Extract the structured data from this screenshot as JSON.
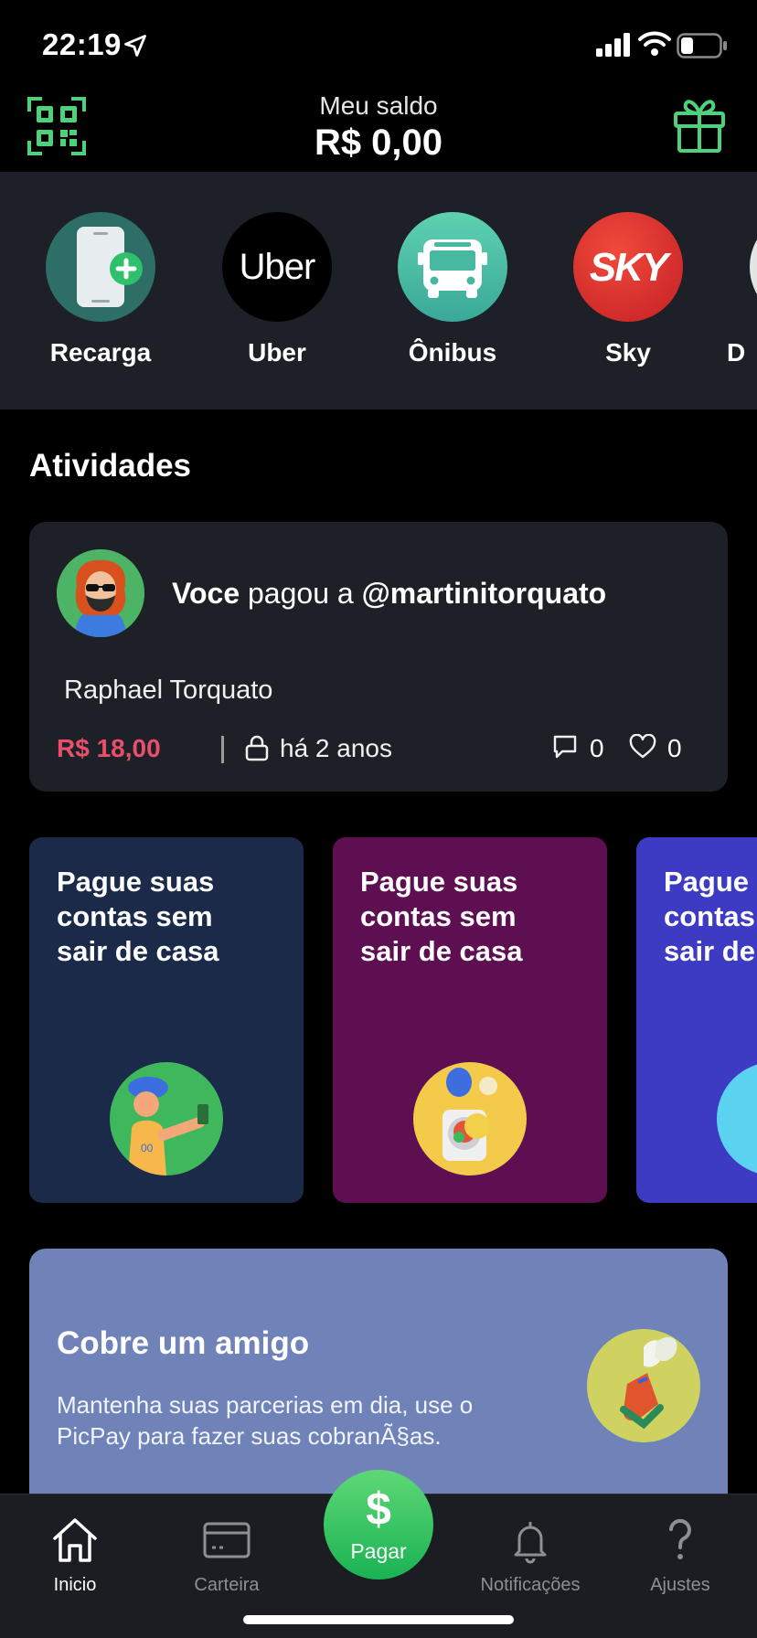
{
  "status_bar": {
    "time": "22:19"
  },
  "header": {
    "balance_label": "Meu saldo",
    "balance_value": "R$ 0,00"
  },
  "shortcuts": [
    {
      "label": "Recarga",
      "icon": "phone-plus-icon",
      "color": "#2d6e66"
    },
    {
      "label": "Uber",
      "icon": "uber-logo",
      "logo_text": "Uber",
      "color": "#000000"
    },
    {
      "label": "Ônibus",
      "icon": "bus-icon",
      "color": "#4cc2a4"
    },
    {
      "label": "Sky",
      "icon": "sky-logo",
      "logo_text": "SKY",
      "color": "#dd2a2a"
    },
    {
      "label": "D",
      "icon": "partial-icon",
      "color": "#e5e5e5"
    }
  ],
  "activities": {
    "section_title": "Atividades",
    "card": {
      "actor": "Voce",
      "verb": "pagou a",
      "target": "@martinitorquato",
      "description": "Raphael Torquato",
      "amount": "R$ 18,00",
      "time_ago": "há 2 anos",
      "comments": "0",
      "likes": "0"
    }
  },
  "promos": [
    {
      "text": "Pague suas contas sem sair de casa",
      "bg": "#1c2a4a",
      "circle": "#3fb75d"
    },
    {
      "text": "Pague suas contas sem sair de casa",
      "bg": "#5e0f52",
      "circle": "#f3ca4a"
    },
    {
      "text": "Pague suas contas sem sair de casa",
      "bg": "#3d3bc4",
      "circle": "#5ad2f0"
    }
  ],
  "cobre": {
    "title": "Cobre um amigo",
    "description": "Mantenha suas parcerias em dia, use o PicPay para fazer suas cobranÃ§as."
  },
  "tabbar": {
    "items": [
      {
        "label": "Inicio",
        "icon": "home-icon",
        "active": true
      },
      {
        "label": "Carteira",
        "icon": "wallet-card-icon",
        "active": false
      },
      {
        "label": "Notificações",
        "icon": "bell-icon",
        "active": false
      },
      {
        "label": "Ajustes",
        "icon": "question-icon",
        "active": false
      }
    ],
    "pay": {
      "symbol": "$",
      "label": "Pagar"
    }
  },
  "colors": {
    "accent_green": "#21c25e",
    "amount_red": "#e8506a",
    "card_bg": "#1e2027"
  }
}
